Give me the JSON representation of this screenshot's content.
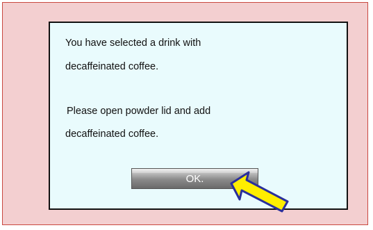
{
  "dialog": {
    "message_lines": [
      "You have selected a drink with",
      "decaffeinated coffee.",
      "Please open powder lid and add",
      "decaffeinated coffee."
    ],
    "ok_label": "OK."
  },
  "icons": {
    "pointer": "arrow-pointer-icon"
  },
  "colors": {
    "screen_background": "#f3cfd0",
    "dialog_background": "#e9fbfd",
    "arrow_fill": "#ffee00",
    "arrow_outline": "#2a2f9c"
  }
}
